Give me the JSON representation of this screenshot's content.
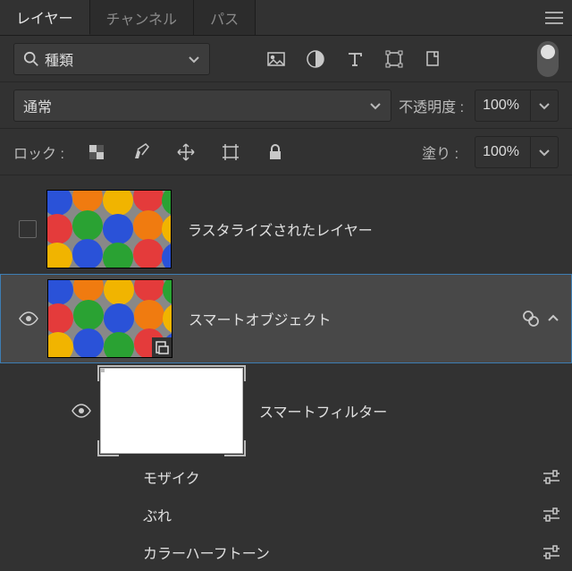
{
  "tabs": {
    "layers": "レイヤー",
    "channels": "チャンネル",
    "paths": "パス"
  },
  "filter": {
    "kind": "種類"
  },
  "blend": {
    "mode": "通常",
    "opacity_label": "不透明度 :",
    "opacity_value": "100%"
  },
  "lock": {
    "label": "ロック :",
    "fill_label": "塗り :",
    "fill_value": "100%"
  },
  "layers": [
    {
      "name": "ラスタライズされたレイヤー"
    },
    {
      "name": "スマートオブジェクト"
    }
  ],
  "smart_filter": {
    "label": "スマートフィルター",
    "items": [
      "モザイク",
      "ぶれ",
      "カラーハーフトーン"
    ]
  }
}
